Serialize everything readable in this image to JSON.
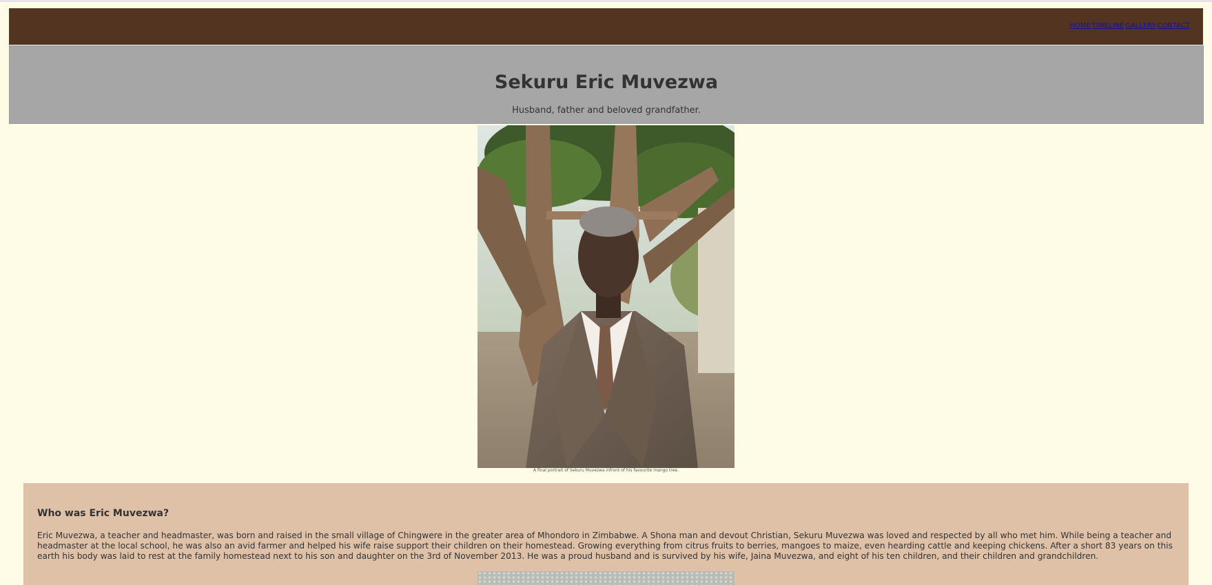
{
  "nav": {
    "links": [
      "HOME",
      "TIMELINE",
      "GALLERY",
      "CONTACT"
    ]
  },
  "banner": {
    "title": "Sekuru Eric Muvezwa",
    "subtitle": "Husband, father and beloved grandfather."
  },
  "portrait": {
    "caption": "A final portrait of Sekuru Muvezwa infront of his favourite mango tree."
  },
  "bio": {
    "heading": "Who was Eric Muvezwa?",
    "text": "Eric Muvezwa, a teacher and headmaster, was born and raised in the small village of Chingwere in the greater area of Mhondoro in Zimbabwe. A Shona man and devout Christian, Sekuru Muvezwa was loved and respected by all who met him. While being a teacher and headmaster at the local school, he was also an avid farmer and helped his wife raise support their children on their homestead. Growing everything from citrus fruits to berries, mangoes to maize, even hearding cattle and keeping chickens. After a short 83 years on this earth his body was laid to rest at the family homestead next to his son and daughter on the 3rd of November 2013. He was a proud husband and is survived by his wife, Jaina Muvezwa, and eight of his ten children, and their children and grandchildren."
  },
  "colors": {
    "page_background": "#fefce6",
    "navbar": "#523421",
    "banner": "#a6a6a6",
    "bio_panel": "#dec1a7",
    "link": "#1a0dab"
  }
}
